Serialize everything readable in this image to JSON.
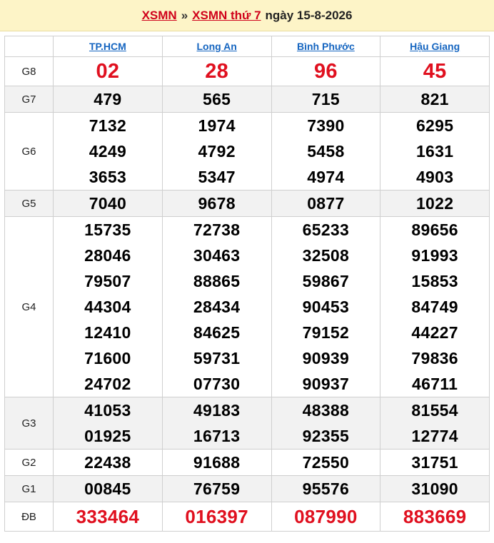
{
  "header": {
    "link1": "XSMN",
    "separator": "»",
    "link2": "XSMN thứ 7",
    "date": "ngày 15-8-2026"
  },
  "provinces": [
    "TP.HCM",
    "Long An",
    "Bình Phước",
    "Hậu Giang"
  ],
  "prizes": [
    {
      "label": "G8",
      "alt": false,
      "style": "big red",
      "values": [
        [
          "02"
        ],
        [
          "28"
        ],
        [
          "96"
        ],
        [
          "45"
        ]
      ]
    },
    {
      "label": "G7",
      "alt": true,
      "style": "",
      "values": [
        [
          "479"
        ],
        [
          "565"
        ],
        [
          "715"
        ],
        [
          "821"
        ]
      ]
    },
    {
      "label": "G6",
      "alt": false,
      "style": "",
      "values": [
        [
          "7132",
          "4249",
          "3653"
        ],
        [
          "1974",
          "4792",
          "5347"
        ],
        [
          "7390",
          "5458",
          "4974"
        ],
        [
          "6295",
          "1631",
          "4903"
        ]
      ]
    },
    {
      "label": "G5",
      "alt": true,
      "style": "",
      "values": [
        [
          "7040"
        ],
        [
          "9678"
        ],
        [
          "0877"
        ],
        [
          "1022"
        ]
      ]
    },
    {
      "label": "G4",
      "alt": false,
      "style": "",
      "values": [
        [
          "15735",
          "28046",
          "79507",
          "44304",
          "12410",
          "71600",
          "24702"
        ],
        [
          "72738",
          "30463",
          "88865",
          "28434",
          "84625",
          "59731",
          "07730"
        ],
        [
          "65233",
          "32508",
          "59867",
          "90453",
          "79152",
          "90939",
          "90937"
        ],
        [
          "89656",
          "91993",
          "15853",
          "84749",
          "44227",
          "79836",
          "46711"
        ]
      ]
    },
    {
      "label": "G3",
      "alt": true,
      "style": "",
      "values": [
        [
          "41053",
          "01925"
        ],
        [
          "49183",
          "16713"
        ],
        [
          "48388",
          "92355"
        ],
        [
          "81554",
          "12774"
        ]
      ]
    },
    {
      "label": "G2",
      "alt": false,
      "style": "",
      "values": [
        [
          "22438"
        ],
        [
          "91688"
        ],
        [
          "72550"
        ],
        [
          "31751"
        ]
      ]
    },
    {
      "label": "G1",
      "alt": true,
      "style": "",
      "values": [
        [
          "00845"
        ],
        [
          "76759"
        ],
        [
          "95576"
        ],
        [
          "31090"
        ]
      ]
    },
    {
      "label": "ĐB",
      "alt": false,
      "style": "db red",
      "values": [
        [
          "333464"
        ],
        [
          "016397"
        ],
        [
          "087990"
        ],
        [
          "883669"
        ]
      ]
    }
  ]
}
